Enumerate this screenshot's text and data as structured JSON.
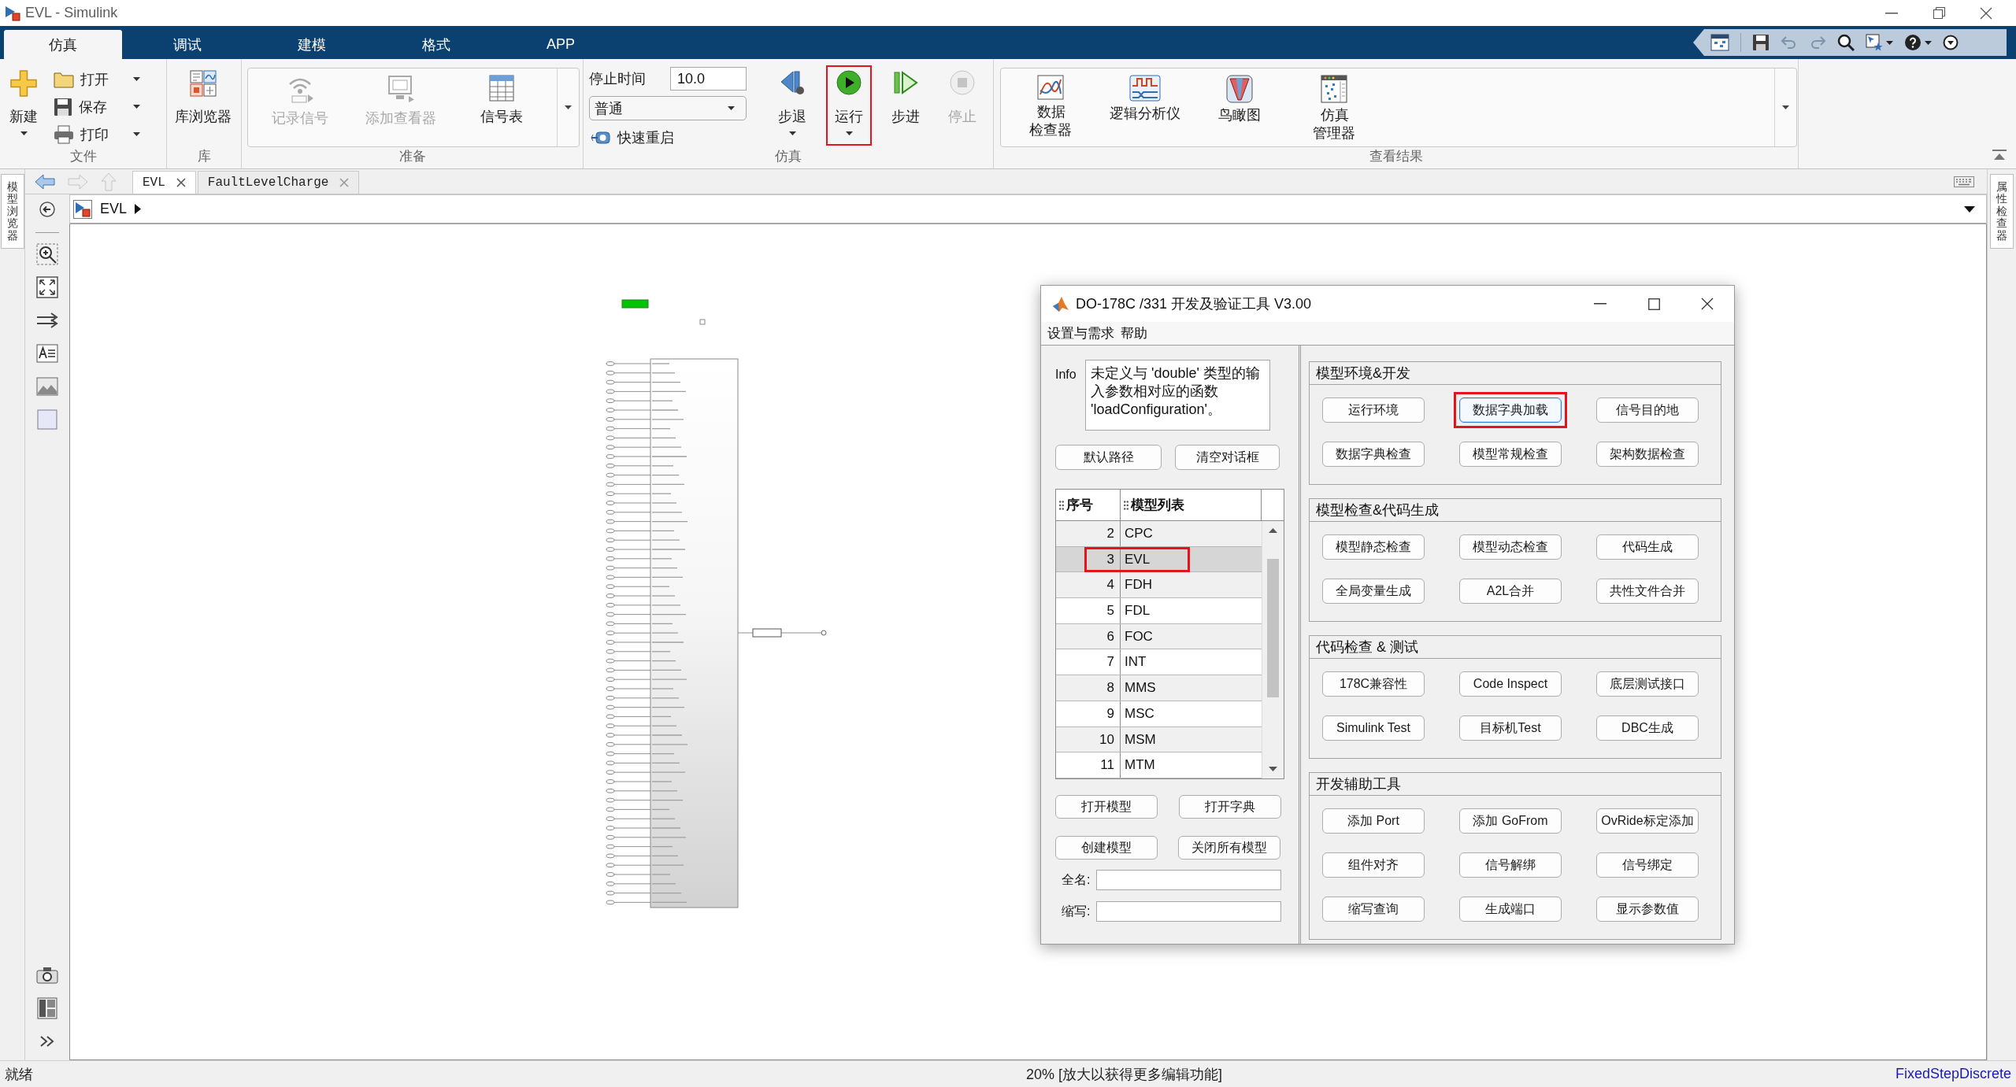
{
  "window": {
    "title": "EVL - Simulink"
  },
  "ribbon_tabs": [
    {
      "label": "仿真",
      "selected": true
    },
    {
      "label": "调试",
      "selected": false
    },
    {
      "label": "建模",
      "selected": false
    },
    {
      "label": "格式",
      "selected": false
    },
    {
      "label": "APP",
      "selected": false
    }
  ],
  "ribbon": {
    "file_group": {
      "label": "文件",
      "new_button": {
        "label": "新建"
      },
      "file_actions": [
        {
          "label": "打开"
        },
        {
          "label": "保存"
        },
        {
          "label": "打印"
        }
      ]
    },
    "library_group": {
      "label": "库",
      "library_browser_button": {
        "label": "库浏览器"
      }
    },
    "prepare_group": {
      "label": "准备",
      "gallery": [
        {
          "label": "记录信号",
          "disabled": true
        },
        {
          "label": "添加查看器",
          "disabled": true
        },
        {
          "label": "信号表",
          "disabled": false
        }
      ]
    },
    "simulation_group": {
      "label": "仿真",
      "stop_time": {
        "label": "停止时间",
        "value": "10.0"
      },
      "mode": {
        "value": "普通"
      },
      "fast_restart": {
        "label": "快速重启"
      },
      "controls": [
        {
          "label": "步退",
          "disabled": false,
          "highlighted": false,
          "has_menu": true
        },
        {
          "label": "运行",
          "disabled": false,
          "highlighted": true,
          "has_menu": true
        },
        {
          "label": "步进",
          "disabled": false,
          "highlighted": false,
          "has_menu": false
        },
        {
          "label": "停止",
          "disabled": true,
          "highlighted": false,
          "has_menu": false
        }
      ]
    },
    "review_group": {
      "label": "查看结果",
      "gallery": [
        {
          "label": "数据检查器"
        },
        {
          "label": "逻辑分析仪"
        },
        {
          "label": "鸟瞰图"
        },
        {
          "label": "仿真管理器"
        }
      ]
    }
  },
  "document_tabs": [
    {
      "label": "EVL",
      "selected": true
    },
    {
      "label": "FaultLevelCharge",
      "selected": false
    }
  ],
  "side_panels": {
    "left": "模型浏览器",
    "right": "属性检查器"
  },
  "breadcrumb": {
    "label": "EVL"
  },
  "dialog": {
    "title": "DO-178C /331 开发及验证工具 V3.00",
    "menu": [
      "设置与需求",
      "帮助"
    ],
    "info": {
      "label": "Info",
      "text": "未定义与 'double' 类型的输入参数相对应的函数 'loadConfiguration'。"
    },
    "path_buttons": [
      "默认路径",
      "清空对话框"
    ],
    "model_table": {
      "columns": [
        "序号",
        "模型列表"
      ],
      "rows": [
        {
          "index": "2",
          "name": "CPC",
          "selected": false,
          "highlighted": false
        },
        {
          "index": "3",
          "name": "EVL",
          "selected": true,
          "highlighted": true
        },
        {
          "index": "4",
          "name": "FDH",
          "selected": false,
          "highlighted": false
        },
        {
          "index": "5",
          "name": "FDL",
          "selected": false,
          "highlighted": false
        },
        {
          "index": "6",
          "name": "FOC",
          "selected": false,
          "highlighted": false
        },
        {
          "index": "7",
          "name": "INT",
          "selected": false,
          "highlighted": false
        },
        {
          "index": "8",
          "name": "MMS",
          "selected": false,
          "highlighted": false
        },
        {
          "index": "9",
          "name": "MSC",
          "selected": false,
          "highlighted": false
        },
        {
          "index": "10",
          "name": "MSM",
          "selected": false,
          "highlighted": false
        },
        {
          "index": "11",
          "name": "MTM",
          "selected": false,
          "highlighted": false
        }
      ]
    },
    "model_buttons": [
      "打开模型",
      "打开字典",
      "创建模型",
      "关闭所有模型"
    ],
    "fields": [
      {
        "label": "全名:"
      },
      {
        "label": "缩写:"
      }
    ],
    "groups": [
      {
        "title": "模型环境&开发",
        "buttons": [
          {
            "label": "运行环境",
            "focused": false,
            "highlighted": false
          },
          {
            "label": "数据字典加载",
            "focused": true,
            "highlighted": true
          },
          {
            "label": "信号目的地",
            "focused": false,
            "highlighted": false
          },
          {
            "label": "数据字典检查",
            "focused": false,
            "highlighted": false
          },
          {
            "label": "模型常规检查",
            "focused": false,
            "highlighted": false
          },
          {
            "label": "架构数据检查",
            "focused": false,
            "highlighted": false
          }
        ]
      },
      {
        "title": "模型检查&代码生成",
        "buttons": [
          {
            "label": "模型静态检查",
            "focused": false,
            "highlighted": false
          },
          {
            "label": "模型动态检查",
            "focused": false,
            "highlighted": false
          },
          {
            "label": "代码生成",
            "focused": false,
            "highlighted": false
          },
          {
            "label": "全局变量生成",
            "focused": false,
            "highlighted": false
          },
          {
            "label": "A2L合并",
            "focused": false,
            "highlighted": false
          },
          {
            "label": "共性文件合并",
            "focused": false,
            "highlighted": false
          }
        ]
      },
      {
        "title": "代码检查 & 测试",
        "buttons": [
          {
            "label": "178C兼容性",
            "focused": false,
            "highlighted": false
          },
          {
            "label": "Code Inspect",
            "focused": false,
            "highlighted": false
          },
          {
            "label": "底层测试接口",
            "focused": false,
            "highlighted": false
          },
          {
            "label": "Simulink Test",
            "focused": false,
            "highlighted": false
          },
          {
            "label": "目标机Test",
            "focused": false,
            "highlighted": false
          },
          {
            "label": "DBC生成",
            "focused": false,
            "highlighted": false
          }
        ]
      },
      {
        "title": "开发辅助工具",
        "buttons": [
          {
            "label": "添加 Port",
            "focused": false,
            "highlighted": false
          },
          {
            "label": "添加 GoFrom",
            "focused": false,
            "highlighted": false
          },
          {
            "label": "OvRide标定添加",
            "focused": false,
            "highlighted": false
          },
          {
            "label": "组件对齐",
            "focused": false,
            "highlighted": false
          },
          {
            "label": "信号解绑",
            "focused": false,
            "highlighted": false
          },
          {
            "label": "信号绑定",
            "focused": false,
            "highlighted": false
          },
          {
            "label": "缩写查询",
            "focused": false,
            "highlighted": false
          },
          {
            "label": "生成端口",
            "focused": false,
            "highlighted": false
          },
          {
            "label": "显示参数值",
            "focused": false,
            "highlighted": false
          }
        ]
      }
    ]
  },
  "status_bar": {
    "status": "就绪",
    "zoom_info": "20% [放大以获得更多编辑功能]",
    "solver": "FixedStepDiscrete"
  }
}
